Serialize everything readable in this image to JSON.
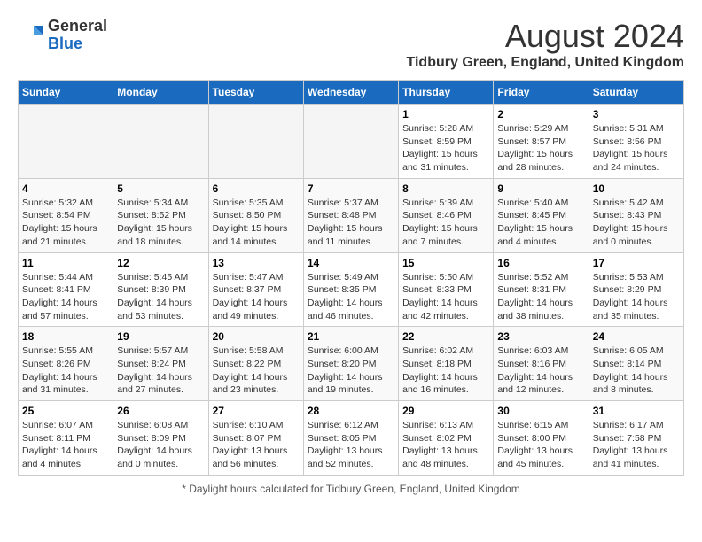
{
  "header": {
    "logo_general": "General",
    "logo_blue": "Blue",
    "month_year": "August 2024",
    "location": "Tidbury Green, England, United Kingdom"
  },
  "days_of_week": [
    "Sunday",
    "Monday",
    "Tuesday",
    "Wednesday",
    "Thursday",
    "Friday",
    "Saturday"
  ],
  "footer": {
    "note": "Daylight hours"
  },
  "weeks": [
    {
      "days": [
        {
          "num": "",
          "empty": true
        },
        {
          "num": "",
          "empty": true
        },
        {
          "num": "",
          "empty": true
        },
        {
          "num": "",
          "empty": true
        },
        {
          "num": "1",
          "sunrise": "5:28 AM",
          "sunset": "8:59 PM",
          "daylight": "15 hours and 31 minutes."
        },
        {
          "num": "2",
          "sunrise": "5:29 AM",
          "sunset": "8:57 PM",
          "daylight": "15 hours and 28 minutes."
        },
        {
          "num": "3",
          "sunrise": "5:31 AM",
          "sunset": "8:56 PM",
          "daylight": "15 hours and 24 minutes."
        }
      ]
    },
    {
      "days": [
        {
          "num": "4",
          "sunrise": "5:32 AM",
          "sunset": "8:54 PM",
          "daylight": "15 hours and 21 minutes."
        },
        {
          "num": "5",
          "sunrise": "5:34 AM",
          "sunset": "8:52 PM",
          "daylight": "15 hours and 18 minutes."
        },
        {
          "num": "6",
          "sunrise": "5:35 AM",
          "sunset": "8:50 PM",
          "daylight": "15 hours and 14 minutes."
        },
        {
          "num": "7",
          "sunrise": "5:37 AM",
          "sunset": "8:48 PM",
          "daylight": "15 hours and 11 minutes."
        },
        {
          "num": "8",
          "sunrise": "5:39 AM",
          "sunset": "8:46 PM",
          "daylight": "15 hours and 7 minutes."
        },
        {
          "num": "9",
          "sunrise": "5:40 AM",
          "sunset": "8:45 PM",
          "daylight": "15 hours and 4 minutes."
        },
        {
          "num": "10",
          "sunrise": "5:42 AM",
          "sunset": "8:43 PM",
          "daylight": "15 hours and 0 minutes."
        }
      ]
    },
    {
      "days": [
        {
          "num": "11",
          "sunrise": "5:44 AM",
          "sunset": "8:41 PM",
          "daylight": "14 hours and 57 minutes."
        },
        {
          "num": "12",
          "sunrise": "5:45 AM",
          "sunset": "8:39 PM",
          "daylight": "14 hours and 53 minutes."
        },
        {
          "num": "13",
          "sunrise": "5:47 AM",
          "sunset": "8:37 PM",
          "daylight": "14 hours and 49 minutes."
        },
        {
          "num": "14",
          "sunrise": "5:49 AM",
          "sunset": "8:35 PM",
          "daylight": "14 hours and 46 minutes."
        },
        {
          "num": "15",
          "sunrise": "5:50 AM",
          "sunset": "8:33 PM",
          "daylight": "14 hours and 42 minutes."
        },
        {
          "num": "16",
          "sunrise": "5:52 AM",
          "sunset": "8:31 PM",
          "daylight": "14 hours and 38 minutes."
        },
        {
          "num": "17",
          "sunrise": "5:53 AM",
          "sunset": "8:29 PM",
          "daylight": "14 hours and 35 minutes."
        }
      ]
    },
    {
      "days": [
        {
          "num": "18",
          "sunrise": "5:55 AM",
          "sunset": "8:26 PM",
          "daylight": "14 hours and 31 minutes."
        },
        {
          "num": "19",
          "sunrise": "5:57 AM",
          "sunset": "8:24 PM",
          "daylight": "14 hours and 27 minutes."
        },
        {
          "num": "20",
          "sunrise": "5:58 AM",
          "sunset": "8:22 PM",
          "daylight": "14 hours and 23 minutes."
        },
        {
          "num": "21",
          "sunrise": "6:00 AM",
          "sunset": "8:20 PM",
          "daylight": "14 hours and 19 minutes."
        },
        {
          "num": "22",
          "sunrise": "6:02 AM",
          "sunset": "8:18 PM",
          "daylight": "14 hours and 16 minutes."
        },
        {
          "num": "23",
          "sunrise": "6:03 AM",
          "sunset": "8:16 PM",
          "daylight": "14 hours and 12 minutes."
        },
        {
          "num": "24",
          "sunrise": "6:05 AM",
          "sunset": "8:14 PM",
          "daylight": "14 hours and 8 minutes."
        }
      ]
    },
    {
      "days": [
        {
          "num": "25",
          "sunrise": "6:07 AM",
          "sunset": "8:11 PM",
          "daylight": "14 hours and 4 minutes."
        },
        {
          "num": "26",
          "sunrise": "6:08 AM",
          "sunset": "8:09 PM",
          "daylight": "14 hours and 0 minutes."
        },
        {
          "num": "27",
          "sunrise": "6:10 AM",
          "sunset": "8:07 PM",
          "daylight": "13 hours and 56 minutes."
        },
        {
          "num": "28",
          "sunrise": "6:12 AM",
          "sunset": "8:05 PM",
          "daylight": "13 hours and 52 minutes."
        },
        {
          "num": "29",
          "sunrise": "6:13 AM",
          "sunset": "8:02 PM",
          "daylight": "13 hours and 48 minutes."
        },
        {
          "num": "30",
          "sunrise": "6:15 AM",
          "sunset": "8:00 PM",
          "daylight": "13 hours and 45 minutes."
        },
        {
          "num": "31",
          "sunrise": "6:17 AM",
          "sunset": "7:58 PM",
          "daylight": "13 hours and 41 minutes."
        }
      ]
    }
  ]
}
